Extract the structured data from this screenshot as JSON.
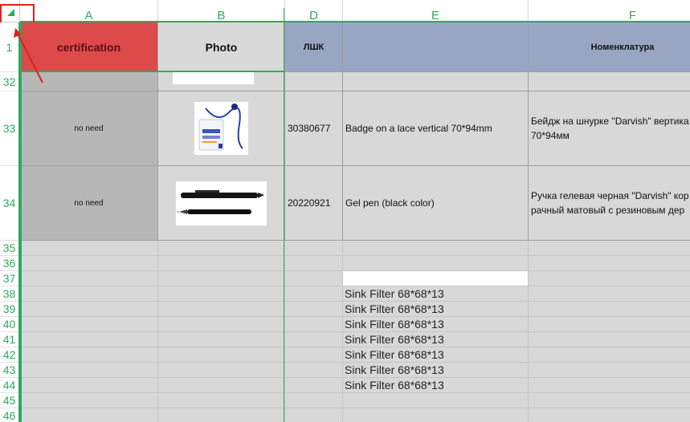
{
  "columns": [
    {
      "letter": "A"
    },
    {
      "letter": "B"
    },
    {
      "letter": "D"
    },
    {
      "letter": "E"
    },
    {
      "letter": "F"
    }
  ],
  "header_row": {
    "number": "1",
    "certification": "certification",
    "photo": "Photo",
    "code": "ЛШК",
    "description": "",
    "nomenclature": "Номенклатура"
  },
  "rows": {
    "r32": {
      "number": "32"
    },
    "r33": {
      "number": "33",
      "certification": "no need",
      "code": "30380677",
      "description": "Badge on a lace  vertical 70*94mm",
      "nomenclature": "Бейдж на шнурке \"Darvish\" вертика 70*94мм",
      "photo_alt": "name badge on lanyard"
    },
    "r34": {
      "number": "34",
      "certification": "no need",
      "code": "20220921",
      "description": "Gel pen (black color)",
      "nomenclature": "Ручка гелевая черная \"Darvish\" кор рачный матовый с резиновым дер",
      "photo_alt": "black gel pens"
    },
    "empty_numbers": [
      "35",
      "36",
      "37"
    ],
    "sink_rows": [
      {
        "number": "38",
        "text": "Sink Filter 68*68*13"
      },
      {
        "number": "39",
        "text": "Sink Filter 68*68*13"
      },
      {
        "number": "40",
        "text": "Sink Filter 68*68*13"
      },
      {
        "number": "41",
        "text": "Sink Filter 68*68*13"
      },
      {
        "number": "42",
        "text": "Sink Filter 68*68*13"
      },
      {
        "number": "43",
        "text": "Sink Filter 68*68*13"
      },
      {
        "number": "44",
        "text": "Sink Filter 68*68*13"
      }
    ],
    "tail_numbers": [
      "45",
      "46"
    ]
  },
  "colors": {
    "accent_green": "#2eaa5c",
    "certification_fill": "#dc4a4a",
    "header_blue": "#98a6c3",
    "body_gray": "#d8d8d8",
    "cert_gray": "#b7b7b7",
    "annotation_red": "#e0221b"
  },
  "icons": {
    "select_all": "select-all-triangle-icon",
    "annotation": "red-arrow-annotation"
  }
}
